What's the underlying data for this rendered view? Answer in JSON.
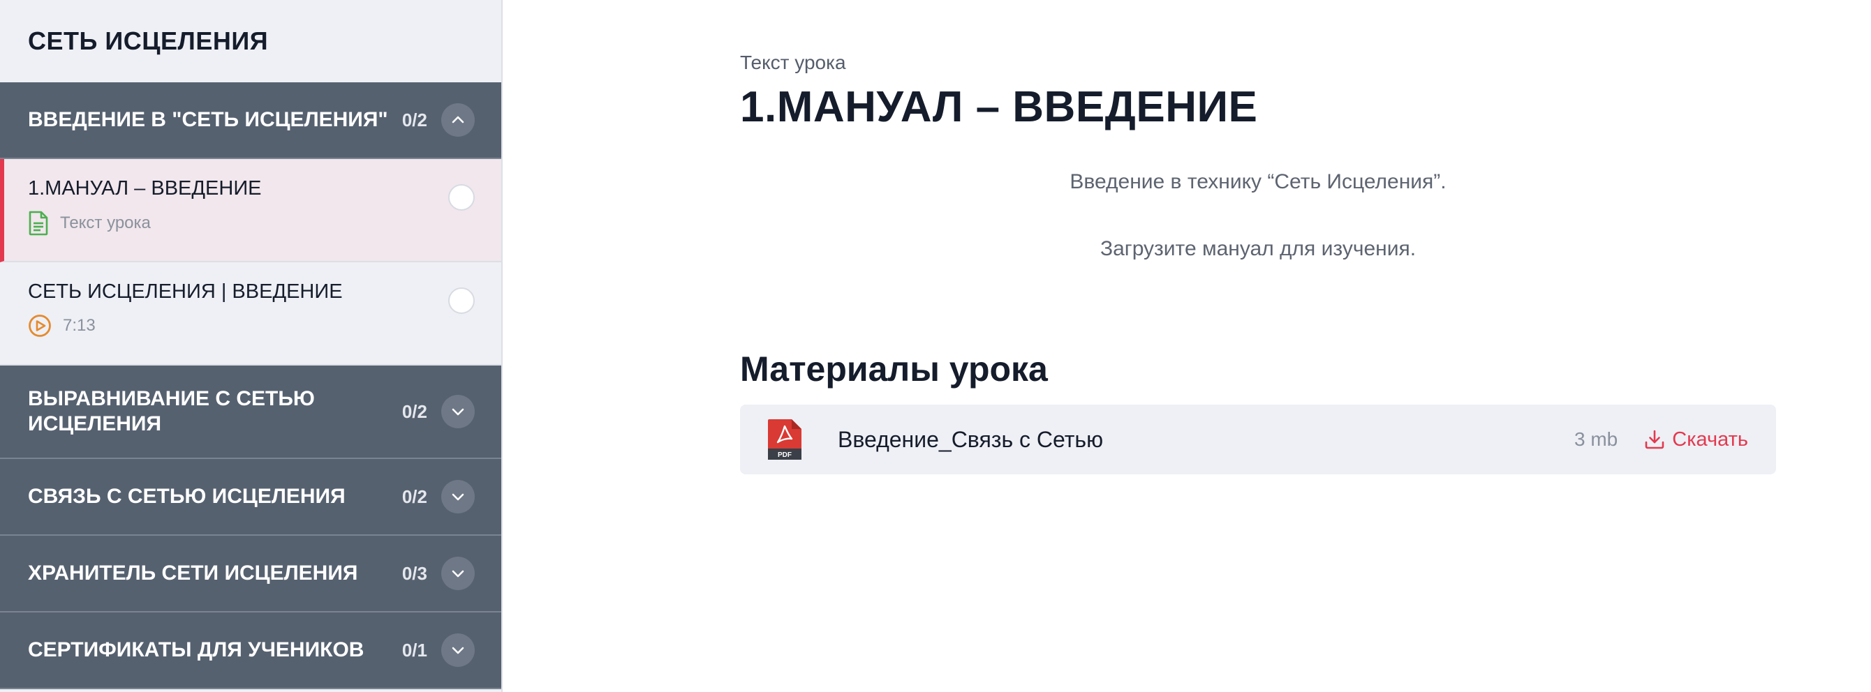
{
  "sidebar": {
    "course_title": "СЕТЬ ИСЦЕЛЕНИЯ",
    "sections": [
      {
        "title": "ВВЕДЕНИЕ В \"СЕТЬ ИСЦЕЛЕНИЯ\"",
        "count": "0/2",
        "expanded": true,
        "icon": "chevron-up-icon",
        "lessons": [
          {
            "title": "1.МАНУАЛ – ВВЕДЕНИЕ",
            "meta": "Текст урока",
            "icon": "document-icon",
            "active": true
          },
          {
            "title": "СЕТЬ ИСЦЕЛЕНИЯ | ВВЕДЕНИЕ",
            "meta": "7:13",
            "icon": "play-icon",
            "active": false
          }
        ]
      },
      {
        "title": "ВЫРАВНИВАНИЕ С СЕТЬЮ ИСЦЕЛЕНИЯ",
        "count": "0/2",
        "expanded": false,
        "icon": "chevron-down-icon"
      },
      {
        "title": "СВЯЗЬ С СЕТЬЮ ИСЦЕЛЕНИЯ",
        "count": "0/2",
        "expanded": false,
        "icon": "chevron-down-icon"
      },
      {
        "title": "ХРАНИТЕЛЬ СЕТИ ИСЦЕЛЕНИЯ",
        "count": "0/3",
        "expanded": false,
        "icon": "chevron-down-icon"
      },
      {
        "title": "СЕРТИФИКАТЫ ДЛЯ УЧЕНИКОВ",
        "count": "0/1",
        "expanded": false,
        "icon": "chevron-down-icon"
      }
    ]
  },
  "main": {
    "lesson_type": "Текст урока",
    "lesson_title": "1.МАНУАЛ – ВВЕДЕНИЕ",
    "paragraphs": [
      "Введение в технику “Сеть Исцеления”.",
      "Загрузите мануал для изучения."
    ],
    "materials_heading": "Материалы урока",
    "materials": [
      {
        "name": "Введение_Связь с Сетью",
        "size": "3 mb",
        "action": "Скачать",
        "icon": "pdf-icon",
        "download_icon": "download-icon"
      }
    ]
  },
  "colors": {
    "accent": "#e3394f",
    "section_bg": "#566170",
    "sidebar_bg": "#eef0f5",
    "active_lesson_bg": "#f1e7ec",
    "text_dark": "#151c2b",
    "document_icon": "#4caf50",
    "play_icon": "#e58a2e"
  }
}
